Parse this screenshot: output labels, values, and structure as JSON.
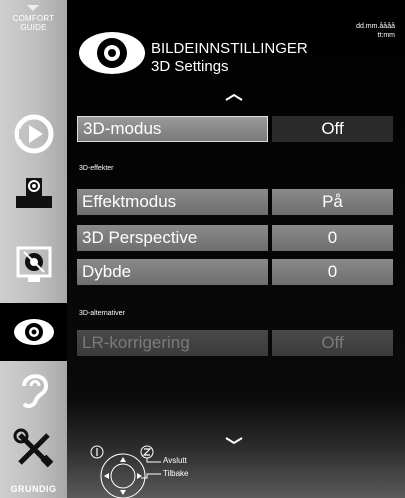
{
  "sidebar": {
    "comfort_guide": [
      "COMFORT",
      "GUIDE"
    ],
    "items": [
      {
        "name": "source-icon"
      },
      {
        "name": "network-icon"
      },
      {
        "name": "settings-icon"
      },
      {
        "name": "picture-eye-icon",
        "active": true
      },
      {
        "name": "ear-icon"
      },
      {
        "name": "tools-icon"
      }
    ],
    "brand": "GRUNDIG"
  },
  "header": {
    "date": "dd.mm.åååå",
    "time": "tt:mm",
    "title": "BILDEINNSTILLINGER",
    "subtitle": "3D Settings"
  },
  "menu": {
    "row_3d_mode": {
      "label": "3D-modus",
      "value": "Off"
    },
    "section_effects": "3D-effekter",
    "row_effect_mode": {
      "label": "Effektmodus",
      "value": "På"
    },
    "row_perspective": {
      "label": "3D Perspective",
      "value": "0"
    },
    "row_depth": {
      "label": "Dybde",
      "value": "0"
    },
    "section_alternatives": "3D-alternativer",
    "row_lr": {
      "label": "LR-korrigering",
      "value": "Off"
    }
  },
  "legend": {
    "exit": "Avslutt",
    "back": "Tilbake"
  },
  "colors": {
    "sidebar": "#c0c0c0",
    "row": "#7c7c7c",
    "selected_value": "#2b2b2b",
    "disabled": "#444444"
  }
}
